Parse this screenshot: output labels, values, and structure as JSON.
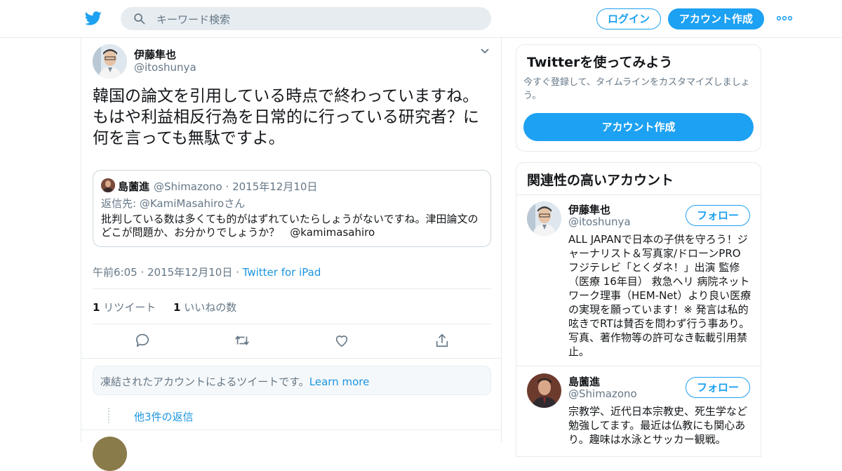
{
  "header": {
    "search_placeholder": "キーワード検索",
    "login_label": "ログイン",
    "signup_label": "アカウント作成"
  },
  "tweet": {
    "author_name": "伊藤隼也",
    "author_handle": "@itoshunya",
    "text": "韓国の論文を引用している時点で終わっていますね。もはや利益相反行為を日常的に行っている研究者？に何を言っても無駄ですよ。",
    "quoted": {
      "author_name": "島薗進",
      "author_handle": "@Shimazono",
      "date": "2015年12月10日",
      "reply_prefix": "返信先: ",
      "reply_to": "@KamiMasahiroさん",
      "text": "批判している数は多くても的がはずれていたらしょうがないですね。津田論文のどこが問題か、お分かりでしょうか？　",
      "mention": "@kamimasahiro"
    },
    "time": "午前6:05 · 2015年12月10日 · ",
    "source": "Twitter for iPad",
    "retweet_count": "1",
    "retweet_label": " リツイート",
    "like_count": "1",
    "like_label": " いいねの数"
  },
  "notice": {
    "text": "凍結されたアカウントによるツイートです。",
    "link": "Learn more"
  },
  "more_replies": "他3件の返信",
  "sidebar": {
    "signup_card": {
      "title": "Twitterを使ってみよう",
      "description": "今すぐ登録して、タイムラインをカスタマイズしましょう。",
      "button": "アカウント作成"
    },
    "related": {
      "title": "関連性の高いアカウント",
      "follow_label": "フォロー",
      "accounts": [
        {
          "name": "伊藤隼也",
          "handle": "@itoshunya",
          "bio": "ALL JAPANで日本の子供を守ろう！ジャーナリスト＆写真家/ドローンPRO フジテレビ「とくダネ！」出演 監修（医療 16年目） 救急ヘリ 病院ネットワーク理事（HEM-Net）より良い医療の実現を願っています！※ 発言は私的呟きでRTは賛否を問わず行う事あり。写真、著作物等の許可なき転載引用禁止。"
        },
        {
          "name": "島薗進",
          "handle": "@Shimazono",
          "bio": "宗教学、近代日本宗教史、死生学など勉強してます。最近は仏教にも関心あり。趣味は水泳とサッカー観戦。"
        }
      ]
    }
  },
  "colors": {
    "accent": "#1da1f2",
    "link": "#1b95e0",
    "muted": "#657786",
    "border": "#e6ecf0"
  }
}
